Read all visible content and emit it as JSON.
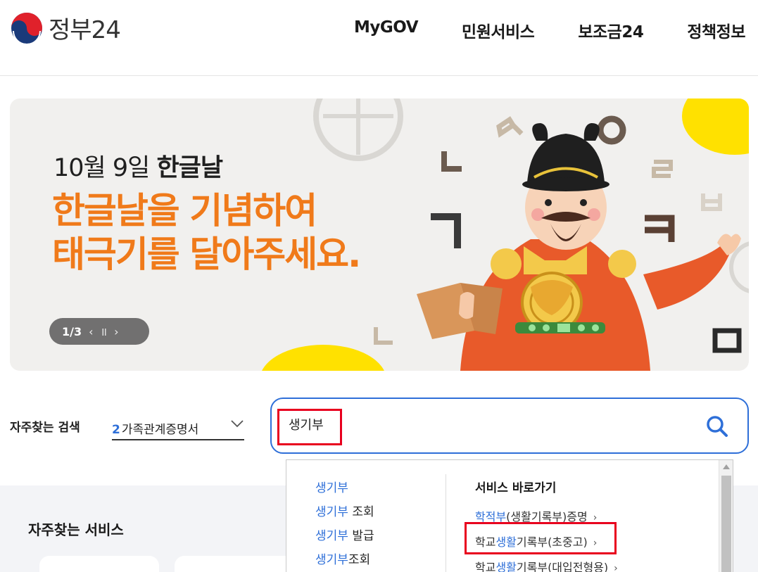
{
  "header": {
    "logo_text": "정부24",
    "nav": [
      "MyGOV",
      "민원서비스",
      "보조금24",
      "정책정보"
    ]
  },
  "banner": {
    "date_plain": "10월 9일 ",
    "date_bold": "한글날",
    "headline_1": "한글날을 기념하여",
    "headline_2": "태극기를 달아주세요.",
    "page": "1/3",
    "prev": "‹",
    "pause": "॥",
    "next": "›"
  },
  "search": {
    "fav_label": "자주찾는 검색",
    "fav_rank": "2",
    "fav_value": "가족관계증명서",
    "query": "생기부"
  },
  "dropdown": {
    "suggestions": [
      {
        "hl": "생기부",
        "rest": ""
      },
      {
        "hl": "생기부",
        "rest": " 조회"
      },
      {
        "hl": "생기부",
        "rest": " 발급"
      },
      {
        "hl": "생기부",
        "rest": "조회"
      }
    ],
    "service_title": "서비스 바로가기",
    "services": [
      {
        "pre": "",
        "hl": "학적부",
        "post": "(생활기록부)증명"
      },
      {
        "pre": "학교",
        "hl": "생활",
        "post": "기록부(초중고)"
      },
      {
        "pre": "학교",
        "hl": "생활",
        "post": "기록부(대입전형용)"
      }
    ]
  },
  "lower": {
    "title": "자주찾는 서비스"
  },
  "colors": {
    "accent": "#2e6fd8",
    "highlight_box": "#e8001e",
    "banner_orange": "#f07a1a"
  }
}
